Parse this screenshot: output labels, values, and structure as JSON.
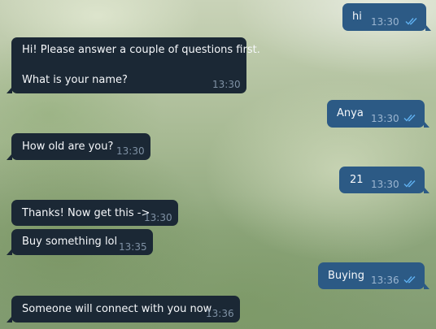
{
  "messages": [
    {
      "direction": "out",
      "text": "hi",
      "time": "13:30",
      "status": "read-double-check-icon"
    },
    {
      "direction": "in",
      "text": "Hi! Please answer a couple of questions first.",
      "text2": "What is your name?",
      "time": "13:30"
    },
    {
      "direction": "out",
      "text": "Anya",
      "time": "13:30",
      "status": "read-double-check-icon"
    },
    {
      "direction": "in",
      "text": "How old are you?",
      "time": "13:30"
    },
    {
      "direction": "out",
      "text": "21",
      "time": "13:30",
      "status": "read-double-check-icon"
    },
    {
      "direction": "in",
      "text": "Thanks! Now get this ->",
      "time": "13:30"
    },
    {
      "direction": "in",
      "text": "Buy something lol",
      "time": "13:35"
    },
    {
      "direction": "out",
      "text": "Buying",
      "time": "13:36",
      "status": "read-double-check-icon"
    },
    {
      "direction": "in",
      "text": "Someone will connect with you now",
      "time": "13:36"
    }
  ],
  "colors": {
    "incoming_bubble": "#1b2835",
    "outgoing_bubble": "#2c5a85",
    "read_check": "#5fb0f0"
  }
}
